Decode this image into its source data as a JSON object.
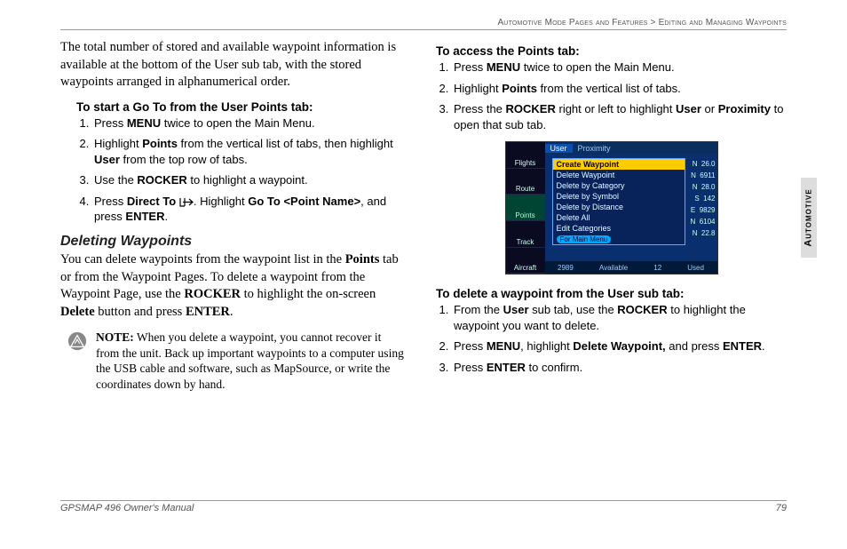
{
  "breadcrumb": {
    "section": "Automotive Mode Pages and Features",
    "sep": " > ",
    "sub": "Editing and Managing Waypoints"
  },
  "sideTab": "Automotive",
  "footer": {
    "title": "GPSMAP 496 Owner's Manual",
    "page": "79"
  },
  "left": {
    "intro": "The total number of stored and available waypoint information is available at the bottom of the User sub tab, with the stored waypoints arranged in alphanumerical order.",
    "proc1": {
      "heading": "To start a Go To from the User Points tab:",
      "steps": [
        {
          "pre": "Press ",
          "b1": "MENU",
          "post": " twice to open the Main Menu."
        },
        {
          "pre": "Highlight ",
          "b1": "Points",
          "mid": " from the vertical list of tabs, then highlight ",
          "b2": "User",
          "post": " from the top row of tabs."
        },
        {
          "pre": "Use the ",
          "b1": "ROCKER",
          "post": " to highlight a waypoint."
        },
        {
          "pre": "Press ",
          "b1": "Direct To ",
          "mid": ". Highlight ",
          "b2": "Go To <Point Name>",
          "mid2": ", and press ",
          "b3": "ENTER",
          "post": "."
        }
      ]
    },
    "section2": {
      "heading": "Deleting Waypoints",
      "body_a": "You can delete waypoints from the waypoint list in the ",
      "body_b1": "Points",
      "body_c": " tab or from the Waypoint Pages. To delete a waypoint from the Waypoint Page, use the ",
      "body_b2": "ROCKER",
      "body_d": " to highlight the on-screen ",
      "body_b3": "Delete",
      "body_e": " button and press ",
      "body_b4": "ENTER",
      "body_f": "."
    },
    "note": {
      "label": "NOTE:",
      "text": " When you delete a waypoint, you cannot recover it from the unit. Back up important waypoints to a computer using the USB cable and software, such as MapSource, or write the coordinates down by hand."
    }
  },
  "right": {
    "proc1": {
      "heading": "To access the Points tab:",
      "steps": [
        {
          "pre": "Press ",
          "b1": "MENU",
          "post": " twice to open the Main Menu."
        },
        {
          "pre": "Highlight ",
          "b1": "Points",
          "post": " from the vertical list of tabs."
        },
        {
          "pre": "Press the ",
          "b1": "ROCKER",
          "mid": " right or left to highlight ",
          "b2": "User",
          "mid2": " or ",
          "b3": "Proximity",
          "post": " to open that sub tab."
        }
      ]
    },
    "screenshot": {
      "leftTabs": [
        "Flights",
        "Route",
        "Points",
        "Track",
        "Aircraft"
      ],
      "topTabs": [
        "User",
        "Proximity"
      ],
      "menu": [
        "Create Waypoint",
        "Delete Waypoint",
        "Delete by Category",
        "Delete by Symbol",
        "Delete by Distance",
        "Delete All",
        "Edit Categories"
      ],
      "hint": "For Main Menu",
      "rows": [
        {
          "d": "N",
          "v": "26.0"
        },
        {
          "d": "N",
          "v": "6911"
        },
        {
          "d": "N",
          "v": "28.0"
        },
        {
          "d": "S",
          "v": "142"
        },
        {
          "d": "E",
          "v": "9829"
        },
        {
          "d": "N",
          "v": "6104"
        },
        {
          "d": "N",
          "v": "22.8"
        }
      ],
      "status": {
        "a": "2989",
        "al": "Available",
        "b": "12",
        "bl": "Used"
      }
    },
    "proc2": {
      "heading": "To delete a waypoint from the User sub tab:",
      "steps": [
        {
          "pre": "From the ",
          "b1": "User",
          "mid": " sub tab, use the ",
          "b2": "ROCKER",
          "post": " to highlight the waypoint you want to delete."
        },
        {
          "pre": "Press ",
          "b1": "MENU",
          "mid": ", highlight ",
          "b2": "Delete Waypoint,",
          "mid2": " and press ",
          "b3": "ENTER",
          "post": "."
        },
        {
          "pre": "Press ",
          "b1": "ENTER",
          "post": " to confirm."
        }
      ]
    }
  }
}
